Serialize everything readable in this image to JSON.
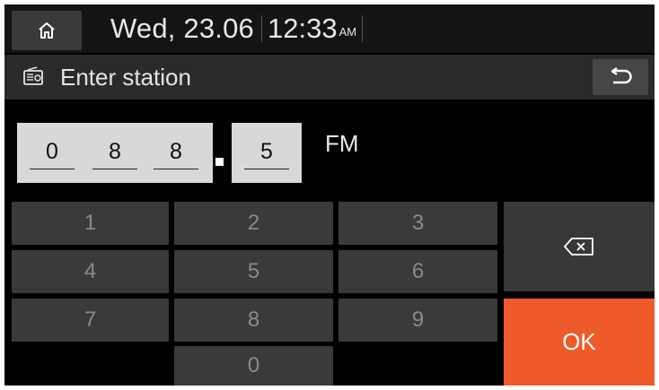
{
  "status_bar": {
    "date": "Wed, 23.06",
    "time": "12:33",
    "ampm": "AM",
    "home_icon": "home-icon"
  },
  "title_bar": {
    "title": "Enter station",
    "radio_icon": "radio-icon",
    "back_icon": "back-arrow-icon"
  },
  "frequency": {
    "digits": [
      "0",
      "8",
      "8"
    ],
    "decimal": "5",
    "separator": ".",
    "band": "FM"
  },
  "keypad": {
    "keys": [
      "1",
      "2",
      "3",
      "4",
      "5",
      "6",
      "7",
      "8",
      "9",
      "0"
    ],
    "backspace_icon": "backspace-icon",
    "ok_label": "OK"
  },
  "colors": {
    "accent": "#ee5a2a",
    "key_bg": "#3a3a3a",
    "key_text": "#8a8a8a",
    "entry_bg": "#d8d8d8"
  }
}
